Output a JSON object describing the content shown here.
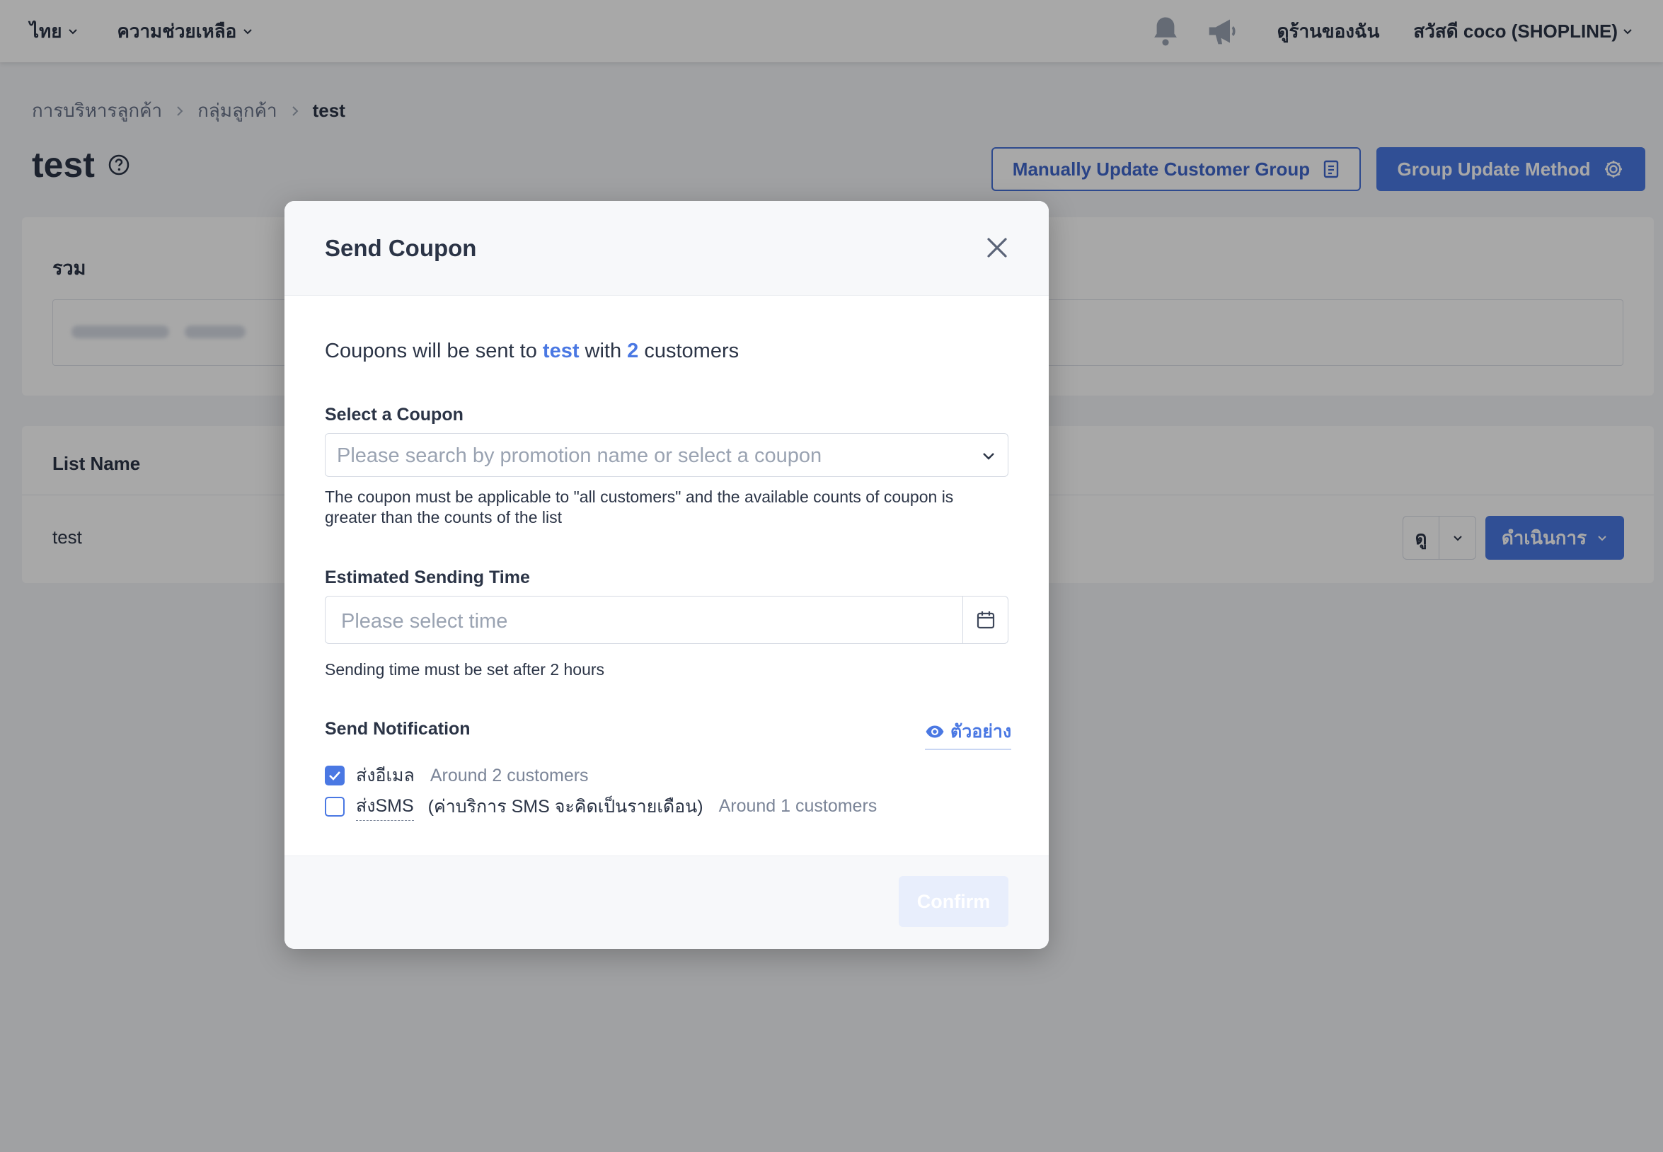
{
  "topbar": {
    "language": "ไทย",
    "help": "ความช่วยเหลือ",
    "icons": [
      "bell-icon",
      "megaphone-icon"
    ],
    "my_store": "ดูร้านของฉัน",
    "greeting": "สวัสดี coco (SHOPLINE)"
  },
  "breadcrumb": {
    "items": [
      "การบริหารลูกค้า",
      "กลุ่มลูกค้า"
    ],
    "current": "test"
  },
  "page": {
    "title": "test",
    "manual_update_label": "Manually Update Customer Group",
    "group_update_label": "Group Update Method"
  },
  "summary": {
    "label": "รวม"
  },
  "list": {
    "header": "List Name",
    "row_name": "test",
    "view_label": "ดู",
    "action_label": "ดำเนินการ"
  },
  "modal": {
    "title": "Send Coupon",
    "intro": {
      "prefix": "Coupons will be sent to ",
      "group": "test",
      "middle": " with ",
      "count": "2",
      "suffix": " customers"
    },
    "coupon": {
      "label": "Select a Coupon",
      "placeholder": "Please search by promotion name or select a coupon",
      "help": "The coupon must be applicable to \"all customers\" and the available counts of coupon is greater than the counts of the list"
    },
    "time": {
      "label": "Estimated Sending Time",
      "placeholder": "Please select time",
      "help": "Sending time must be set after 2 hours"
    },
    "notification": {
      "label": "Send Notification",
      "preview": "ตัวอย่าง",
      "email": {
        "label": "ส่งอีเมล",
        "checked": true,
        "audience": "Around 2 customers"
      },
      "sms": {
        "label": "ส่งSMS",
        "checked": false,
        "note": "(ค่าบริการ SMS จะคิดเป็นรายเดือน)",
        "audience": "Around 1 customers"
      }
    },
    "confirm_label": "Confirm"
  },
  "colors": {
    "accent": "#4a78e3",
    "text": "#2b3446",
    "muted": "#7b8598",
    "placeholder": "#9aa3b2",
    "overlay": "rgba(0,0,0,0.34)"
  }
}
